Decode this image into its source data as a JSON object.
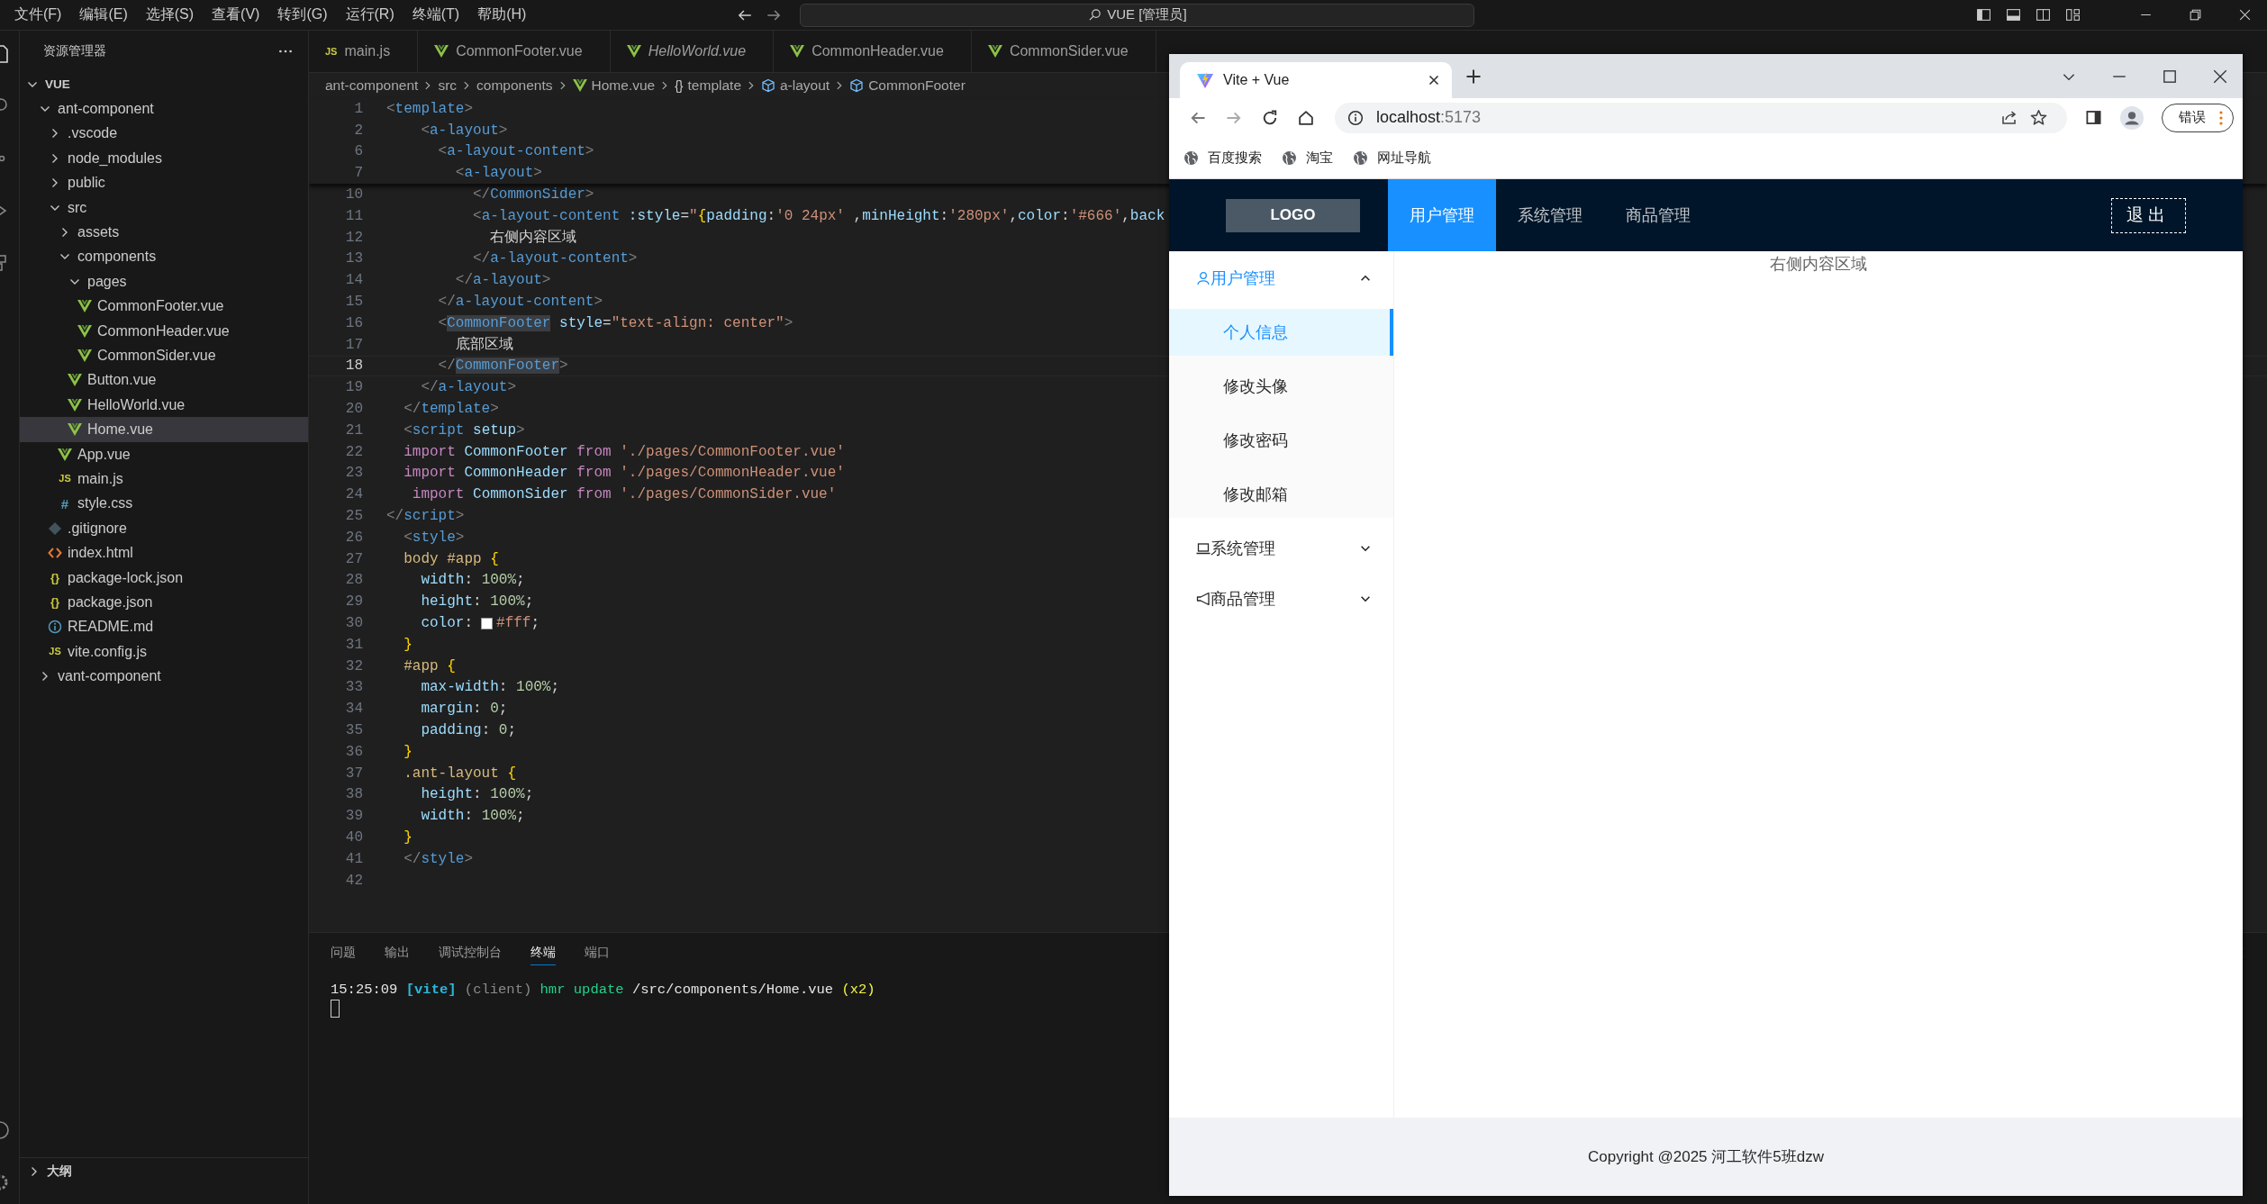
{
  "title_bar": {
    "menu": [
      "文件(F)",
      "编辑(E)",
      "选择(S)",
      "查看(V)",
      "转到(G)",
      "运行(R)",
      "终端(T)",
      "帮助(H)"
    ],
    "search": "VUE [管理员]"
  },
  "explorer": {
    "title": "资源管理器",
    "root": {
      "label": "VUE",
      "expanded": true
    },
    "tree": [
      {
        "label": "ant-component",
        "kind": "folder",
        "expanded": true,
        "selected": false,
        "children": [
          {
            "label": ".vscode",
            "kind": "folder",
            "expanded": false,
            "selected": false
          },
          {
            "label": "node_modules",
            "kind": "folder",
            "expanded": false,
            "selected": false
          },
          {
            "label": "public",
            "kind": "folder",
            "expanded": false,
            "selected": false
          },
          {
            "label": "src",
            "kind": "folder",
            "expanded": true,
            "selected": false,
            "children": [
              {
                "label": "assets",
                "kind": "folder",
                "expanded": false,
                "selected": false
              },
              {
                "label": "components",
                "kind": "folder",
                "expanded": true,
                "selected": false,
                "children": [
                  {
                    "label": "pages",
                    "kind": "folder",
                    "expanded": true,
                    "selected": false,
                    "children": [
                      {
                        "label": "CommonFooter.vue",
                        "kind": "vue",
                        "selected": false
                      },
                      {
                        "label": "CommonHeader.vue",
                        "kind": "vue",
                        "selected": false
                      },
                      {
                        "label": "CommonSider.vue",
                        "kind": "vue",
                        "selected": false
                      }
                    ]
                  },
                  {
                    "label": "Button.vue",
                    "kind": "vue",
                    "selected": false
                  },
                  {
                    "label": "HelloWorld.vue",
                    "kind": "vue",
                    "selected": false
                  },
                  {
                    "label": "Home.vue",
                    "kind": "vue",
                    "selected": true
                  }
                ]
              },
              {
                "label": "App.vue",
                "kind": "vue",
                "selected": false
              },
              {
                "label": "main.js",
                "kind": "js",
                "badge": "JS",
                "selected": false
              },
              {
                "label": "style.css",
                "kind": "css",
                "badge": "#",
                "selected": false
              }
            ]
          },
          {
            "label": ".gitignore",
            "kind": "git",
            "selected": false
          },
          {
            "label": "index.html",
            "kind": "html",
            "selected": false
          },
          {
            "label": "package-lock.json",
            "kind": "json",
            "badge": "{}",
            "selected": false
          },
          {
            "label": "package.json",
            "kind": "json",
            "badge": "{}",
            "selected": false
          },
          {
            "label": "README.md",
            "kind": "info",
            "selected": false
          },
          {
            "label": "vite.config.js",
            "kind": "js",
            "badge": "JS",
            "selected": false
          }
        ]
      },
      {
        "label": "vant-component",
        "kind": "folder",
        "expanded": false,
        "selected": false
      }
    ],
    "outline": {
      "label": "大纲",
      "expanded": false
    }
  },
  "editor": {
    "tabs": [
      {
        "label": "main.js",
        "kind": "js",
        "badge": "JS",
        "italic": false,
        "selected": false
      },
      {
        "label": "CommonFooter.vue",
        "kind": "vue",
        "italic": false,
        "selected": false
      },
      {
        "label": "HelloWorld.vue",
        "kind": "vue",
        "italic": true,
        "selected": false
      },
      {
        "label": "CommonHeader.vue",
        "kind": "vue",
        "italic": false,
        "selected": false
      },
      {
        "label": "CommonSider.vue",
        "kind": "vue",
        "italic": false,
        "selected": false
      }
    ],
    "breadcrumb": [
      {
        "label": "ant-component",
        "kind": "folder"
      },
      {
        "label": "src",
        "kind": "folder"
      },
      {
        "label": "components",
        "kind": "folder"
      },
      {
        "label": "Home.vue",
        "kind": "vue"
      },
      {
        "label": "template",
        "kind": "braces",
        "badge": "{}"
      },
      {
        "label": "a-layout",
        "kind": "element"
      },
      {
        "label": "CommonFooter",
        "kind": "element"
      }
    ],
    "sticky": [
      {
        "n": "1",
        "current": false,
        "code": [
          {
            "kind": "p",
            "text": "<"
          },
          {
            "kind": "tag",
            "text": "template"
          },
          {
            "kind": "p",
            "text": ">"
          }
        ]
      },
      {
        "n": "2",
        "current": false,
        "code": [
          {
            "kind": "p",
            "text": "    <"
          },
          {
            "kind": "tag",
            "text": "a-layout"
          },
          {
            "kind": "p",
            "text": ">"
          }
        ]
      },
      {
        "n": "6",
        "current": false,
        "code": [
          {
            "kind": "p",
            "text": "      <"
          },
          {
            "kind": "tag",
            "text": "a-layout-content"
          },
          {
            "kind": "p",
            "text": ">"
          }
        ]
      },
      {
        "n": "7",
        "current": false,
        "code": [
          {
            "kind": "p",
            "text": "        <"
          },
          {
            "kind": "tag",
            "text": "a-layout"
          },
          {
            "kind": "p",
            "text": ">"
          }
        ]
      }
    ],
    "lines": [
      {
        "n": "10",
        "current": false,
        "code": [
          {
            "kind": "p",
            "text": "          </"
          },
          {
            "kind": "tag",
            "text": "CommonSider"
          },
          {
            "kind": "p",
            "text": ">"
          }
        ]
      },
      {
        "n": "11",
        "current": false,
        "code": [
          {
            "kind": "p",
            "text": "          <"
          },
          {
            "kind": "tag",
            "text": "a-layout-content"
          },
          {
            "kind": "attr",
            "text": " :style"
          },
          {
            "kind": "txt",
            "text": "="
          },
          {
            "kind": "str",
            "text": "\""
          },
          {
            "kind": "brace",
            "text": "{"
          },
          {
            "kind": "attr",
            "text": "padding"
          },
          {
            "kind": "txt",
            "text": ":"
          },
          {
            "kind": "str",
            "text": "'0 24px'"
          },
          {
            "kind": "txt",
            "text": " ,"
          },
          {
            "kind": "attr",
            "text": "minHeight"
          },
          {
            "kind": "txt",
            "text": ":"
          },
          {
            "kind": "str",
            "text": "'280px'"
          },
          {
            "kind": "txt",
            "text": ","
          },
          {
            "kind": "attr",
            "text": "color"
          },
          {
            "kind": "txt",
            "text": ":"
          },
          {
            "kind": "str",
            "text": "'#666'"
          },
          {
            "kind": "txt",
            "text": ","
          },
          {
            "kind": "attr",
            "text": "back"
          }
        ]
      },
      {
        "n": "12",
        "current": false,
        "code": [
          {
            "kind": "txt",
            "text": "            右侧内容区域"
          }
        ]
      },
      {
        "n": "13",
        "current": false,
        "code": [
          {
            "kind": "p",
            "text": "          </"
          },
          {
            "kind": "tag",
            "text": "a-layout-content"
          },
          {
            "kind": "p",
            "text": ">"
          }
        ]
      },
      {
        "n": "14",
        "current": false,
        "code": [
          {
            "kind": "p",
            "text": "        </"
          },
          {
            "kind": "tag",
            "text": "a-layout"
          },
          {
            "kind": "p",
            "text": ">"
          }
        ]
      },
      {
        "n": "15",
        "current": false,
        "code": [
          {
            "kind": "p",
            "text": "      </"
          },
          {
            "kind": "tag",
            "text": "a-layout-content"
          },
          {
            "kind": "p",
            "text": ">"
          }
        ]
      },
      {
        "n": "16",
        "current": false,
        "code": [
          {
            "kind": "p",
            "text": "      <"
          },
          {
            "kind": "hl",
            "text": "CommonFooter"
          },
          {
            "kind": "attr",
            "text": " style"
          },
          {
            "kind": "txt",
            "text": "="
          },
          {
            "kind": "str",
            "text": "\"text-align: center\""
          },
          {
            "kind": "p",
            "text": ">"
          }
        ]
      },
      {
        "n": "17",
        "current": false,
        "code": [
          {
            "kind": "txt",
            "text": "        底部区域"
          }
        ]
      },
      {
        "n": "18",
        "current": true,
        "code": [
          {
            "kind": "p",
            "text": "      </"
          },
          {
            "kind": "hl",
            "text": "CommonFooter"
          },
          {
            "kind": "p",
            "text": ">"
          }
        ]
      },
      {
        "n": "19",
        "current": false,
        "code": [
          {
            "kind": "p",
            "text": "    </"
          },
          {
            "kind": "tag",
            "text": "a-layout"
          },
          {
            "kind": "p",
            "text": ">"
          }
        ]
      },
      {
        "n": "20",
        "current": false,
        "code": [
          {
            "kind": "p",
            "text": "  </"
          },
          {
            "kind": "tag",
            "text": "template"
          },
          {
            "kind": "p",
            "text": ">"
          }
        ]
      },
      {
        "n": "21",
        "current": false,
        "code": [
          {
            "kind": "p",
            "text": "  <"
          },
          {
            "kind": "tag",
            "text": "script"
          },
          {
            "kind": "attr",
            "text": " setup"
          },
          {
            "kind": "p",
            "text": ">"
          }
        ]
      },
      {
        "n": "22",
        "current": false,
        "code": [
          {
            "kind": "kw",
            "text": "  import"
          },
          {
            "kind": "attr",
            "text": " CommonFooter"
          },
          {
            "kind": "kw",
            "text": " from"
          },
          {
            "kind": "str",
            "text": " './pages/CommonFooter.vue'"
          }
        ]
      },
      {
        "n": "23",
        "current": false,
        "code": [
          {
            "kind": "kw",
            "text": "  import"
          },
          {
            "kind": "attr",
            "text": " CommonHeader"
          },
          {
            "kind": "kw",
            "text": " from"
          },
          {
            "kind": "str",
            "text": " './pages/CommonHeader.vue'"
          }
        ]
      },
      {
        "n": "24",
        "current": false,
        "code": [
          {
            "kind": "kw",
            "text": "   import"
          },
          {
            "kind": "attr",
            "text": " CommonSider"
          },
          {
            "kind": "kw",
            "text": " from"
          },
          {
            "kind": "str",
            "text": " './pages/CommonSider.vue'"
          }
        ]
      },
      {
        "n": "25",
        "current": false,
        "code": [
          {
            "kind": "p",
            "text": "</"
          },
          {
            "kind": "tag",
            "text": "script"
          },
          {
            "kind": "p",
            "text": ">"
          }
        ]
      },
      {
        "n": "26",
        "current": false,
        "code": [
          {
            "kind": "p",
            "text": "  <"
          },
          {
            "kind": "tag",
            "text": "style"
          },
          {
            "kind": "p",
            "text": ">"
          }
        ]
      },
      {
        "n": "27",
        "current": false,
        "code": [
          {
            "kind": "sel",
            "text": "  body #app"
          },
          {
            "kind": "brace",
            "text": " {"
          }
        ]
      },
      {
        "n": "28",
        "current": false,
        "code": [
          {
            "kind": "prop",
            "text": "    width"
          },
          {
            "kind": "txt",
            "text": ":"
          },
          {
            "kind": "num",
            "text": " 100%"
          },
          {
            "kind": "txt",
            "text": ";"
          }
        ]
      },
      {
        "n": "29",
        "current": false,
        "code": [
          {
            "kind": "prop",
            "text": "    height"
          },
          {
            "kind": "txt",
            "text": ":"
          },
          {
            "kind": "num",
            "text": " 100%"
          },
          {
            "kind": "txt",
            "text": ";"
          }
        ]
      },
      {
        "n": "30",
        "current": false,
        "code": [
          {
            "kind": "prop",
            "text": "    color"
          },
          {
            "kind": "txt",
            "text": ":"
          },
          {
            "kind": "swatch",
            "text": "#fff"
          },
          {
            "kind": "txt",
            "text": ";"
          }
        ]
      },
      {
        "n": "31",
        "current": false,
        "code": [
          {
            "kind": "brace",
            "text": "  }"
          }
        ]
      },
      {
        "n": "32",
        "current": false,
        "code": [
          {
            "kind": "sel",
            "text": "  #app"
          },
          {
            "kind": "brace",
            "text": " {"
          }
        ]
      },
      {
        "n": "33",
        "current": false,
        "code": [
          {
            "kind": "prop",
            "text": "    max-width"
          },
          {
            "kind": "txt",
            "text": ":"
          },
          {
            "kind": "num",
            "text": " 100%"
          },
          {
            "kind": "txt",
            "text": ";"
          }
        ]
      },
      {
        "n": "34",
        "current": false,
        "code": [
          {
            "kind": "prop",
            "text": "    margin"
          },
          {
            "kind": "txt",
            "text": ":"
          },
          {
            "kind": "num",
            "text": " 0"
          },
          {
            "kind": "txt",
            "text": ";"
          }
        ]
      },
      {
        "n": "35",
        "current": false,
        "code": [
          {
            "kind": "prop",
            "text": "    padding"
          },
          {
            "kind": "txt",
            "text": ":"
          },
          {
            "kind": "num",
            "text": " 0"
          },
          {
            "kind": "txt",
            "text": ";"
          }
        ]
      },
      {
        "n": "36",
        "current": false,
        "code": [
          {
            "kind": "brace",
            "text": "  }"
          }
        ]
      },
      {
        "n": "37",
        "current": false,
        "code": [
          {
            "kind": "sel",
            "text": "  .ant-layout"
          },
          {
            "kind": "brace",
            "text": " {"
          }
        ]
      },
      {
        "n": "38",
        "current": false,
        "code": [
          {
            "kind": "prop",
            "text": "    height"
          },
          {
            "kind": "txt",
            "text": ":"
          },
          {
            "kind": "num",
            "text": " 100%"
          },
          {
            "kind": "txt",
            "text": ";"
          }
        ]
      },
      {
        "n": "39",
        "current": false,
        "code": [
          {
            "kind": "prop",
            "text": "    width"
          },
          {
            "kind": "txt",
            "text": ":"
          },
          {
            "kind": "num",
            "text": " 100%"
          },
          {
            "kind": "txt",
            "text": ";"
          }
        ]
      },
      {
        "n": "40",
        "current": false,
        "code": [
          {
            "kind": "brace",
            "text": "  }"
          }
        ]
      },
      {
        "n": "41",
        "current": false,
        "code": [
          {
            "kind": "p",
            "text": "  </"
          },
          {
            "kind": "tag",
            "text": "style"
          },
          {
            "kind": "p",
            "text": ">"
          }
        ]
      },
      {
        "n": "42",
        "current": false
      }
    ]
  },
  "panel": {
    "tabs": [
      {
        "label": "问题",
        "selected": false
      },
      {
        "label": "输出",
        "selected": false
      },
      {
        "label": "调试控制台",
        "selected": false
      },
      {
        "label": "终端",
        "selected": true
      },
      {
        "label": "端口",
        "selected": false
      }
    ],
    "terminal": [
      {
        "kind": "time",
        "text": "15:25:09"
      },
      {
        "kind": "vite",
        "text": " [vite]"
      },
      {
        "kind": "dim",
        "text": " (client)"
      },
      {
        "kind": "ok",
        "text": " hmr update"
      },
      {
        "kind": "path",
        "text": " /src/components/Home.vue"
      },
      {
        "kind": "warn",
        "text": " (x2)"
      }
    ]
  },
  "browser": {
    "tab": {
      "title": "Vite + Vue",
      "selected": true
    },
    "address": {
      "host": "localhost",
      "port": ":5173"
    },
    "bookmarks": [
      "百度搜索",
      "淘宝",
      "网址导航"
    ],
    "profile_button": "错误",
    "page": {
      "logo": "LOGO",
      "nav": [
        {
          "label": "用户管理",
          "selected": true
        },
        {
          "label": "系统管理",
          "selected": false
        },
        {
          "label": "商品管理",
          "selected": false
        }
      ],
      "logout": "退出",
      "menu": [
        {
          "label": "用户管理",
          "kind": "user",
          "expanded": true,
          "children": [
            {
              "label": "个人信息",
              "selected": true
            },
            {
              "label": "修改头像",
              "selected": false
            },
            {
              "label": "修改密码",
              "selected": false
            },
            {
              "label": "修改邮箱",
              "selected": false
            }
          ]
        },
        {
          "label": "系统管理",
          "kind": "laptop",
          "expanded": false
        },
        {
          "label": "商品管理",
          "kind": "megaphone",
          "expanded": false
        }
      ],
      "content": "右侧内容区域",
      "footer": "Copyright @2025 河工软件5班dzw"
    }
  }
}
